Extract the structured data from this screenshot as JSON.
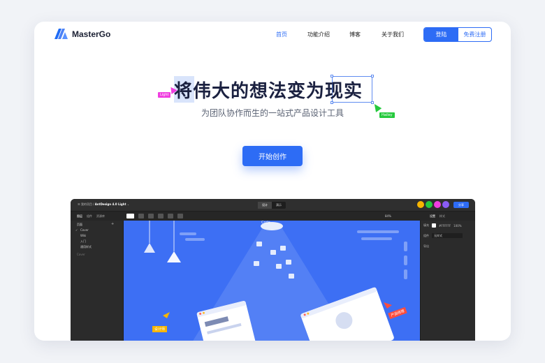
{
  "brand": {
    "name": "MasterGo"
  },
  "nav": {
    "links": [
      "首页",
      "功能介绍",
      "博客",
      "关于我们"
    ],
    "active": "首页",
    "login_label": "登陆",
    "register_label": "免费注册"
  },
  "hero": {
    "title": "将伟大的想法变为现实",
    "subtitle": "为团队协作而生的一站式产品设计工具",
    "cta_label": "开始创作",
    "cursor_tags": [
      "Light",
      "Hailey"
    ]
  },
  "app": {
    "breadcrumb_prefix": "我的项目",
    "file_name": "AntDesign 4.0 Light",
    "modes": [
      "设计",
      "演示"
    ],
    "active_mode": "设计",
    "share_label": "分享",
    "left_tabs": [
      "图层",
      "组件",
      "资源库"
    ],
    "active_left_tab": "图层",
    "zoom": "84%",
    "right_tabs": [
      "设置",
      "样式"
    ],
    "active_right_tab": "设置",
    "pages_title": "页面",
    "pages": [
      "Cover",
      "Wiki",
      "入门",
      "通用样式"
    ],
    "active_page": "Cover",
    "layers_label": "Cover",
    "right_panel": {
      "fill_label": "填充",
      "fill_value": "#FFFFFF",
      "fill_opacity": "100%",
      "style_label": "组件",
      "style_value": "无样式",
      "export_label": "导出"
    },
    "canvas_labels": {
      "code": "Code",
      "design": "设计师",
      "product": "产品经理"
    },
    "avatar_colors": [
      "#f7b500",
      "#25c93d",
      "#2d6cf5",
      "#f03de0",
      "#8a5cf5"
    ],
    "canvas_color": "#3d6ff4"
  },
  "colors": {
    "accent": "#2d6cf5",
    "title": "#1b2140",
    "page_bg": "#f1f3f7"
  }
}
